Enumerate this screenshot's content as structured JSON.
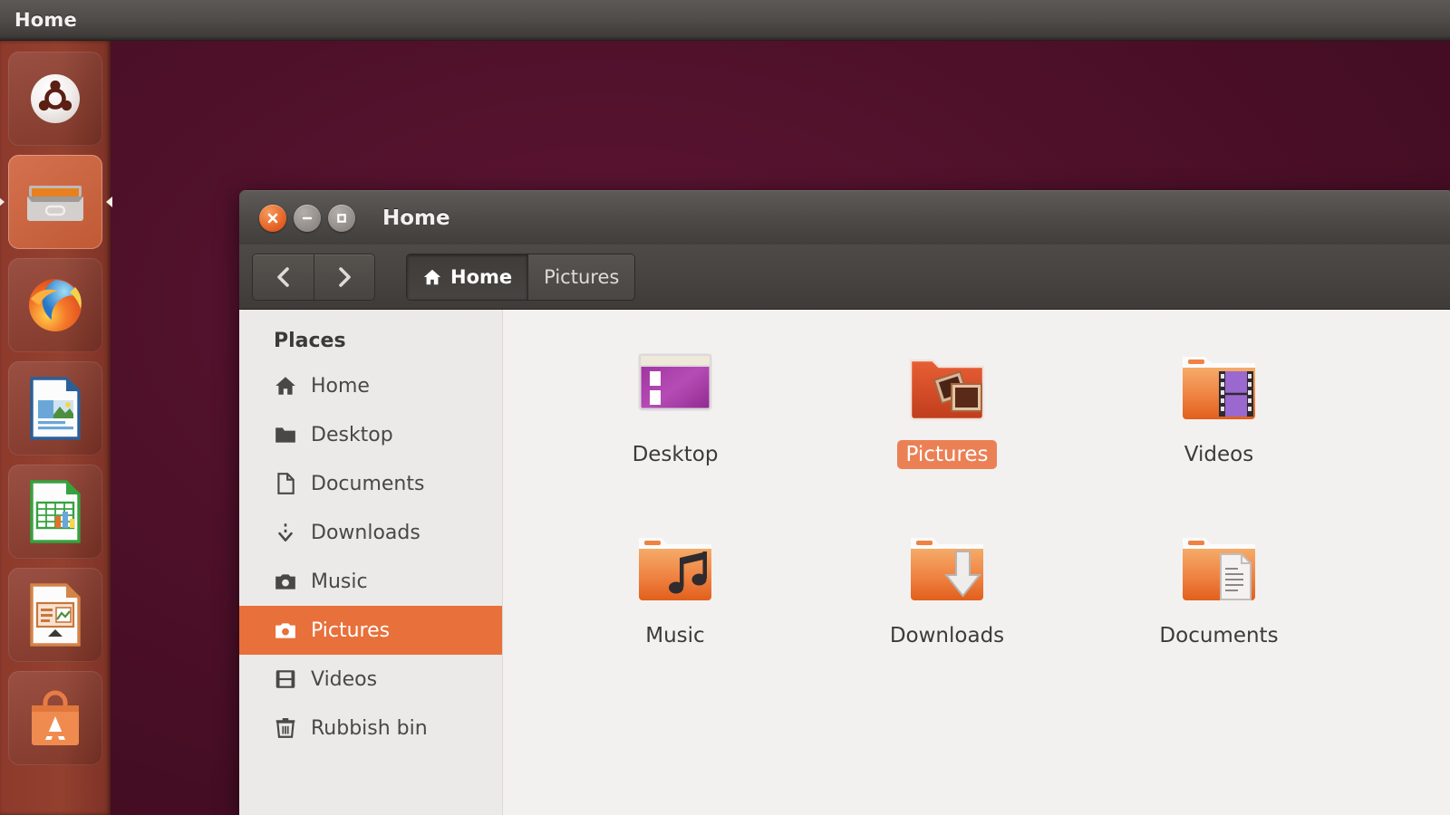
{
  "panel": {
    "title": "Home"
  },
  "launcher": {
    "items": [
      {
        "name": "ubuntu-dash",
        "label": "Dash home",
        "running": false
      },
      {
        "name": "files",
        "label": "Files",
        "running": true
      },
      {
        "name": "firefox",
        "label": "Firefox Web Browser",
        "running": false
      },
      {
        "name": "libreoffice-writer",
        "label": "LibreOffice Writer",
        "running": false
      },
      {
        "name": "libreoffice-calc",
        "label": "LibreOffice Calc",
        "running": false
      },
      {
        "name": "libreoffice-impress",
        "label": "LibreOffice Impress",
        "running": false
      },
      {
        "name": "software-center",
        "label": "Ubuntu Software Centre",
        "running": false
      }
    ]
  },
  "window": {
    "title": "Home",
    "buttons": {
      "close": "close-icon",
      "minimize": "minimize-icon",
      "maximize": "maximize-icon"
    },
    "toolbar": {
      "back": "back-icon",
      "forward": "forward-icon",
      "breadcrumbs": [
        {
          "label": "Home",
          "icon": "home-icon",
          "active": true
        },
        {
          "label": "Pictures",
          "icon": null,
          "active": false
        }
      ]
    },
    "sidebar": {
      "title": "Places",
      "items": [
        {
          "label": "Home",
          "icon": "home-icon",
          "selected": false
        },
        {
          "label": "Desktop",
          "icon": "folder-icon",
          "selected": false
        },
        {
          "label": "Documents",
          "icon": "document-icon",
          "selected": false
        },
        {
          "label": "Downloads",
          "icon": "download-icon",
          "selected": false
        },
        {
          "label": "Music",
          "icon": "camera-icon",
          "selected": false
        },
        {
          "label": "Pictures",
          "icon": "camera-icon",
          "selected": true
        },
        {
          "label": "Videos",
          "icon": "film-icon",
          "selected": false
        },
        {
          "label": "Rubbish bin",
          "icon": "trash-icon",
          "selected": false
        }
      ]
    },
    "files": [
      {
        "label": "Desktop",
        "icon": "desktop-window-icon",
        "selected": false
      },
      {
        "label": "Pictures",
        "icon": "pictures-folder-icon",
        "selected": true
      },
      {
        "label": "Videos",
        "icon": "videos-folder-icon",
        "selected": false
      },
      {
        "label": "Music",
        "icon": "music-folder-icon",
        "selected": false
      },
      {
        "label": "Downloads",
        "icon": "downloads-folder-icon",
        "selected": false
      },
      {
        "label": "Documents",
        "icon": "documents-folder-icon",
        "selected": false
      }
    ]
  },
  "colors": {
    "accent_orange": "#e8703a",
    "selection_label": "#ec8055",
    "desktop_aubergine": "#4e1029",
    "launcher_bg": "#93402f",
    "panel_bg": "#514d4a",
    "content_bg": "#f2f1f0",
    "sidebar_bg": "#eceae8"
  }
}
